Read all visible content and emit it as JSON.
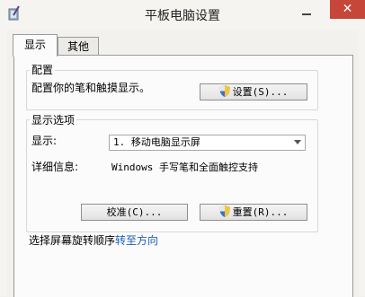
{
  "window": {
    "title": "平板电脑设置",
    "close_glyph": "✕"
  },
  "tabs": [
    {
      "label": "显示"
    },
    {
      "label": "其他"
    }
  ],
  "config_group": {
    "label": "配置",
    "description": "配置你的笔和触摸显示。",
    "setup_button": "设置(S)..."
  },
  "display_group": {
    "label": "显示选项",
    "display_label": "显示:",
    "display_value": "1. 移动电脑显示屏",
    "details_label": "详细信息:",
    "details_value": "Windows 手写笔和全面触控支持",
    "calibrate_button": "校准(C)...",
    "reset_button": "重置(R)..."
  },
  "rotation": {
    "prefix": "选择屏幕旋转顺序",
    "link": "转至方向"
  },
  "colors": {
    "close": "#c6463a",
    "link": "#1a5fb4"
  }
}
